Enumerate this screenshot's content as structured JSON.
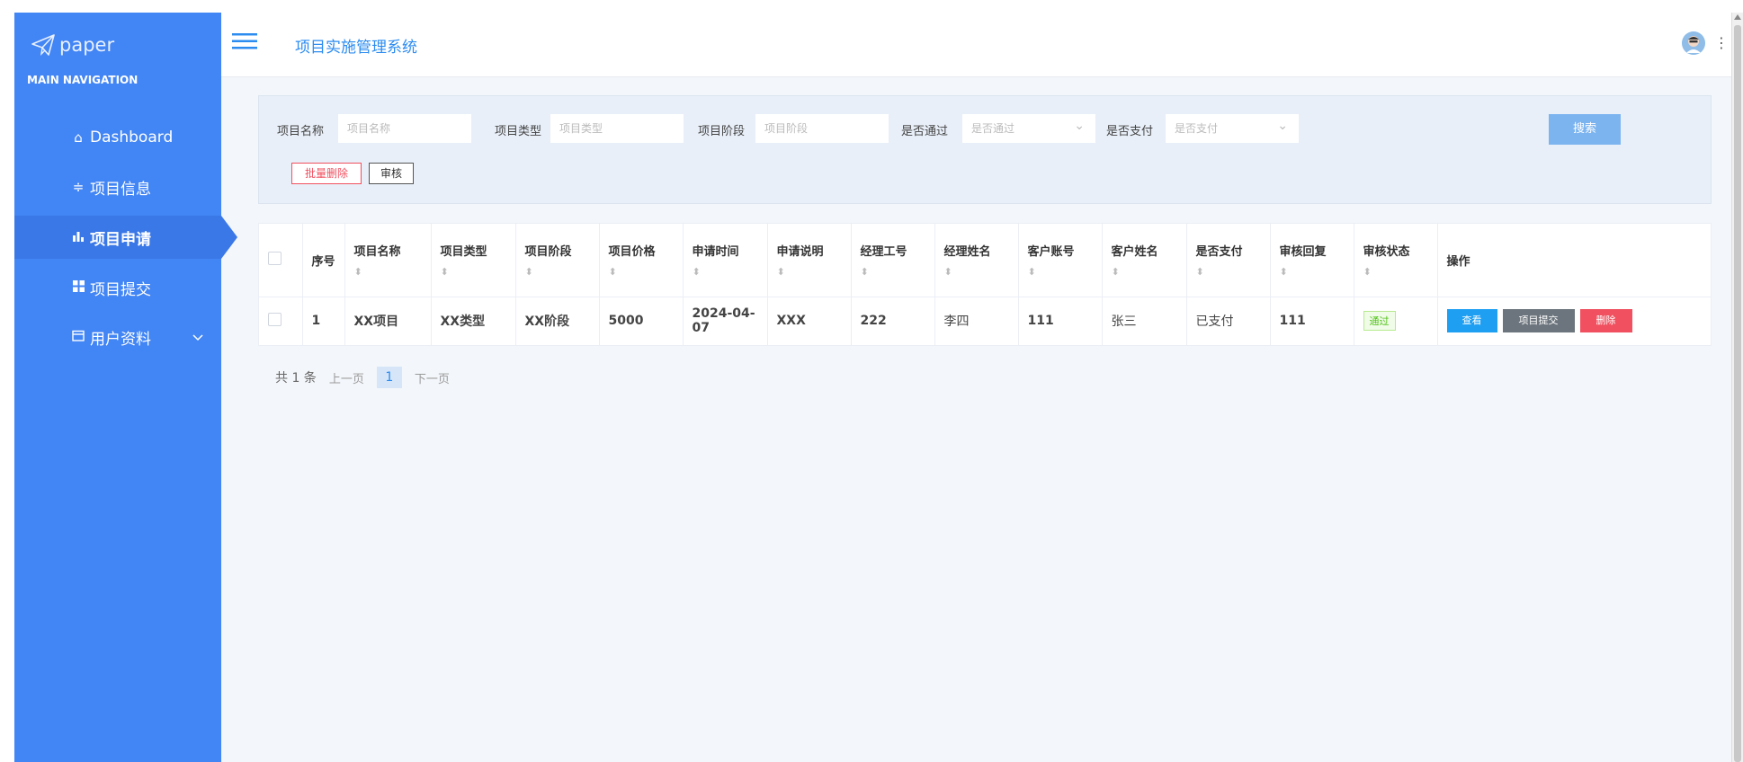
{
  "app": {
    "logo_text": "paper",
    "title": "项目实施管理系统"
  },
  "sidebar": {
    "header": "MAIN NAVIGATION",
    "items": [
      {
        "label": "Dashboard",
        "icon": "home-icon",
        "active": false
      },
      {
        "label": "项目信息",
        "icon": "sliders-icon",
        "active": false
      },
      {
        "label": "项目申请",
        "icon": "bar-chart-icon",
        "active": true
      },
      {
        "label": "项目提交",
        "icon": "grid-icon",
        "active": false
      },
      {
        "label": "用户资料",
        "icon": "calendar-icon",
        "active": false,
        "has_submenu": true
      }
    ]
  },
  "search": {
    "fields": [
      {
        "label": "项目名称",
        "placeholder": "项目名称"
      },
      {
        "label": "项目类型",
        "placeholder": "项目类型"
      },
      {
        "label": "项目阶段",
        "placeholder": "项目阶段"
      },
      {
        "label": "是否通过",
        "placeholder": "是否通过"
      },
      {
        "label": "是否支付",
        "placeholder": "是否支付"
      }
    ],
    "search_button": "搜索",
    "batch_delete": "批量删除",
    "audit": "审核"
  },
  "table": {
    "headers": [
      "序号",
      "项目名称",
      "项目类型",
      "项目阶段",
      "项目价格",
      "申请时间",
      "申请说明",
      "经理工号",
      "经理姓名",
      "客户账号",
      "客户姓名",
      "是否支付",
      "审核回复",
      "审核状态",
      "操作"
    ],
    "rows": [
      {
        "index": "1",
        "name": "XX项目",
        "type": "XX类型",
        "stage": "XX阶段",
        "price": "5000",
        "time": "2024-04-07",
        "desc": "XXX",
        "mgr_id": "222",
        "mgr_name": "李四",
        "cust_acc": "111",
        "cust_name": "张三",
        "paid": "已支付",
        "reply": "111",
        "status": "通过",
        "actions": {
          "view": "查看",
          "submit": "项目提交",
          "delete": "删除"
        }
      }
    ]
  },
  "pagination": {
    "total": "共 1 条",
    "prev": "上一页",
    "current": "1",
    "next": "下一页"
  },
  "colors": {
    "sidebar": "#4285f4",
    "accent": "#2d8cf0",
    "view": "#1e9ff2",
    "submit": "#6c757d",
    "delete": "#f0505f",
    "status": "#52c41a"
  }
}
